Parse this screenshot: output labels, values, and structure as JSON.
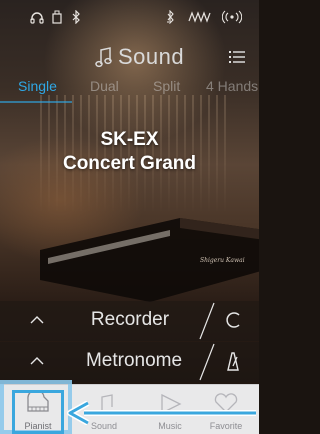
{
  "status_bar": {
    "icons": [
      "headphones-icon",
      "usb-icon",
      "bluetooth-icon",
      "bluetooth-audio-icon",
      "midi-icon",
      "wireless-icon"
    ]
  },
  "header": {
    "title": "Sound",
    "note_icon": "music-note-icon",
    "menu_icon": "list-menu-icon"
  },
  "tabs": [
    {
      "label": "Single",
      "active": true
    },
    {
      "label": "Dual",
      "active": false
    },
    {
      "label": "Split",
      "active": false
    },
    {
      "label": "4 Hands",
      "active": false
    }
  ],
  "sound": {
    "name_line1": "SK-EX",
    "name_line2": "Concert Grand",
    "brand_mark": "Shigeru Kawai"
  },
  "rows": [
    {
      "label": "Recorder",
      "button_icon": "record-icon"
    },
    {
      "label": "Metronome",
      "button_icon": "metronome-icon"
    }
  ],
  "bottom_nav": [
    {
      "label": "Pianist",
      "icon": "piano-icon",
      "selected": true
    },
    {
      "label": "Sound",
      "icon": "music-note-icon",
      "selected": false
    },
    {
      "label": "Music",
      "icon": "play-icon",
      "selected": false
    },
    {
      "label": "Favorite",
      "icon": "heart-icon",
      "selected": false
    }
  ],
  "colors": {
    "accent": "#2fa8e6",
    "highlight": "#3aa7de"
  }
}
